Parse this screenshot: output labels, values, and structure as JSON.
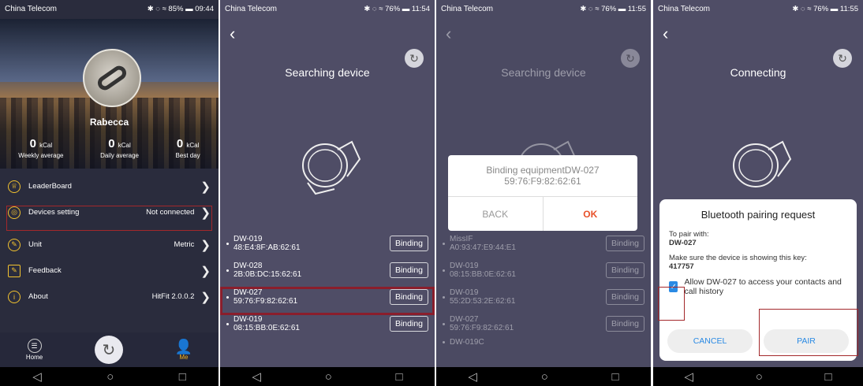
{
  "screen1": {
    "status": {
      "carrier": "China Telecom",
      "right": "✱ ◌ ≈ 85% ▬ 09:44"
    },
    "username": "Rabecca",
    "stats": [
      {
        "value": "0",
        "unit": "kCal",
        "label": "Weekly average"
      },
      {
        "value": "0",
        "unit": "kCal",
        "label": "Daily average"
      },
      {
        "value": "0",
        "unit": "kCal",
        "label": "Best day"
      }
    ],
    "menu": [
      {
        "label": "LeaderBoard",
        "value": ""
      },
      {
        "label": "Devices setting",
        "value": "Not connected"
      },
      {
        "label": "Unit",
        "value": "Metric"
      },
      {
        "label": "Feedback",
        "value": ""
      },
      {
        "label": "About",
        "value": "HitFit 2.0.0.2"
      }
    ],
    "tabs": {
      "home": "Home",
      "me": "Me"
    }
  },
  "screen2": {
    "status": {
      "carrier": "China Telecom",
      "right": "✱ ◌ ≈ 76% ▬ 11:54"
    },
    "title": "Searching device",
    "devices": [
      {
        "name": "DW-019",
        "mac": "48:E4:8F:AB:62:61"
      },
      {
        "name": "DW-028",
        "mac": "2B:0B:DC:15:62:61"
      },
      {
        "name": "DW-027",
        "mac": "59:76:F9:82:62:61"
      },
      {
        "name": "DW-019",
        "mac": "08:15:BB:0E:62:61"
      }
    ],
    "bind_label": "Binding"
  },
  "screen3": {
    "status": {
      "carrier": "China Telecom",
      "right": "✱ ◌ ≈ 76% ▬ 11:55"
    },
    "title": "Searching device",
    "devices": [
      {
        "name": "MissIF",
        "mac": "A0:93:47:E9:44:E1"
      },
      {
        "name": "DW-019",
        "mac": "08:15:BB:0E:62:61"
      },
      {
        "name": "DW-019",
        "mac": "55:2D:53:2E:62:61"
      },
      {
        "name": "DW-027",
        "mac": "59:76:F9:82:62:61"
      }
    ],
    "partial": "DW-019C",
    "bind_label": "Binding",
    "dialog": {
      "line1": "Binding equipmentDW-027",
      "line2": "59:76:F9:82:62:61",
      "back": "BACK",
      "ok": "OK"
    }
  },
  "screen4": {
    "status": {
      "carrier": "China Telecom",
      "right": "✱ ◌ ≈ 76% ▬ 11:55"
    },
    "title": "Connecting",
    "dialog": {
      "title": "Bluetooth pairing request",
      "pair_with": "To pair with:",
      "device": "DW-027",
      "key_text": "Make sure the device is showing this key:",
      "key": "417757",
      "allow": "Allow DW-027 to access your contacts and call history",
      "cancel": "CANCEL",
      "pair": "PAIR"
    }
  },
  "nav": {
    "back": "◁",
    "home": "○",
    "recent": "□"
  }
}
